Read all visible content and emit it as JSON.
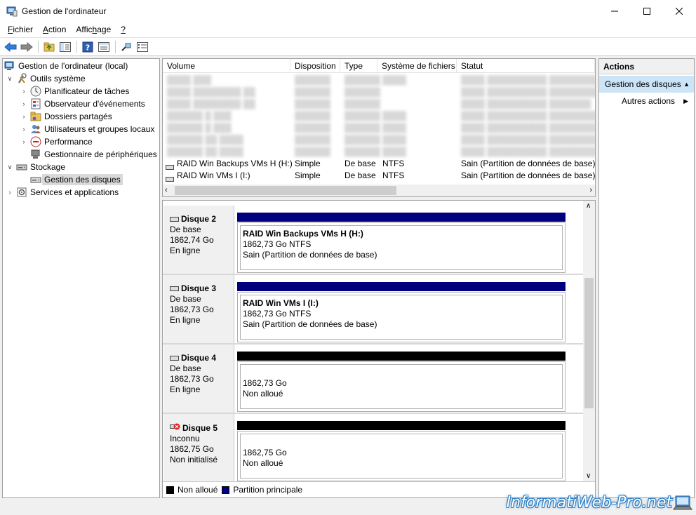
{
  "window": {
    "title": "Gestion de l'ordinateur"
  },
  "menu": [
    {
      "pre": "",
      "u": "F",
      "post": "ichier"
    },
    {
      "pre": "",
      "u": "A",
      "post": "ction"
    },
    {
      "pre": "Affic",
      "u": "h",
      "post": "age"
    },
    {
      "pre": "",
      "u": "?",
      "post": ""
    }
  ],
  "tree": {
    "root": "Gestion de l'ordinateur (local)",
    "system_tools": "Outils système",
    "task_scheduler": "Planificateur de tâches",
    "event_viewer": "Observateur d'événements",
    "shared_folders": "Dossiers partagés",
    "local_users": "Utilisateurs et groupes locaux",
    "performance": "Performance",
    "device_manager": "Gestionnaire de périphériques",
    "storage": "Stockage",
    "disk_management": "Gestion des disques",
    "services": "Services et applications"
  },
  "volumes": {
    "columns": [
      "Volume",
      "Disposition",
      "Type",
      "Système de fichiers",
      "Statut"
    ],
    "rows": [
      {
        "volume": "RAID Win Backups VMs H (H:)",
        "layout": "Simple",
        "type": "De base",
        "fs": "NTFS",
        "status": "Sain (Partition de données de base)"
      },
      {
        "volume": "RAID Win VMs I (I:)",
        "layout": "Simple",
        "type": "De base",
        "fs": "NTFS",
        "status": "Sain (Partition de données de base)"
      }
    ]
  },
  "disks": [
    {
      "name": "Disque 2",
      "kind": "De base",
      "size": "1862,74 Go",
      "state": "En ligne",
      "bar_color": "#00007f",
      "part_title": "RAID Win Backups VMs H  (H:)",
      "part_size": "1862,73 Go NTFS",
      "part_status": "Sain (Partition de données de base)",
      "error": false
    },
    {
      "name": "Disque 3",
      "kind": "De base",
      "size": "1862,73 Go",
      "state": "En ligne",
      "bar_color": "#00007f",
      "part_title": "RAID Win VMs I  (I:)",
      "part_size": "1862,73 Go NTFS",
      "part_status": "Sain (Partition de données de base)",
      "error": false
    },
    {
      "name": "Disque 4",
      "kind": "De base",
      "size": "1862,73 Go",
      "state": "En ligne",
      "bar_color": "#000000",
      "part_title": "",
      "part_size": "1862,73 Go",
      "part_status": "Non alloué",
      "error": false
    },
    {
      "name": "Disque 5",
      "kind": "Inconnu",
      "size": "1862,75 Go",
      "state": "Non initialisé",
      "bar_color": "#000000",
      "part_title": "",
      "part_size": "1862,75 Go",
      "part_status": "Non alloué",
      "error": true
    }
  ],
  "legend": {
    "unallocated": "Non alloué",
    "primary": "Partition principale",
    "unallocated_color": "#000000",
    "primary_color": "#00007f"
  },
  "actions": {
    "header": "Actions",
    "selected": "Gestion des disques",
    "more": "Autres actions"
  },
  "watermark": "InformatiWeb-Pro.net"
}
